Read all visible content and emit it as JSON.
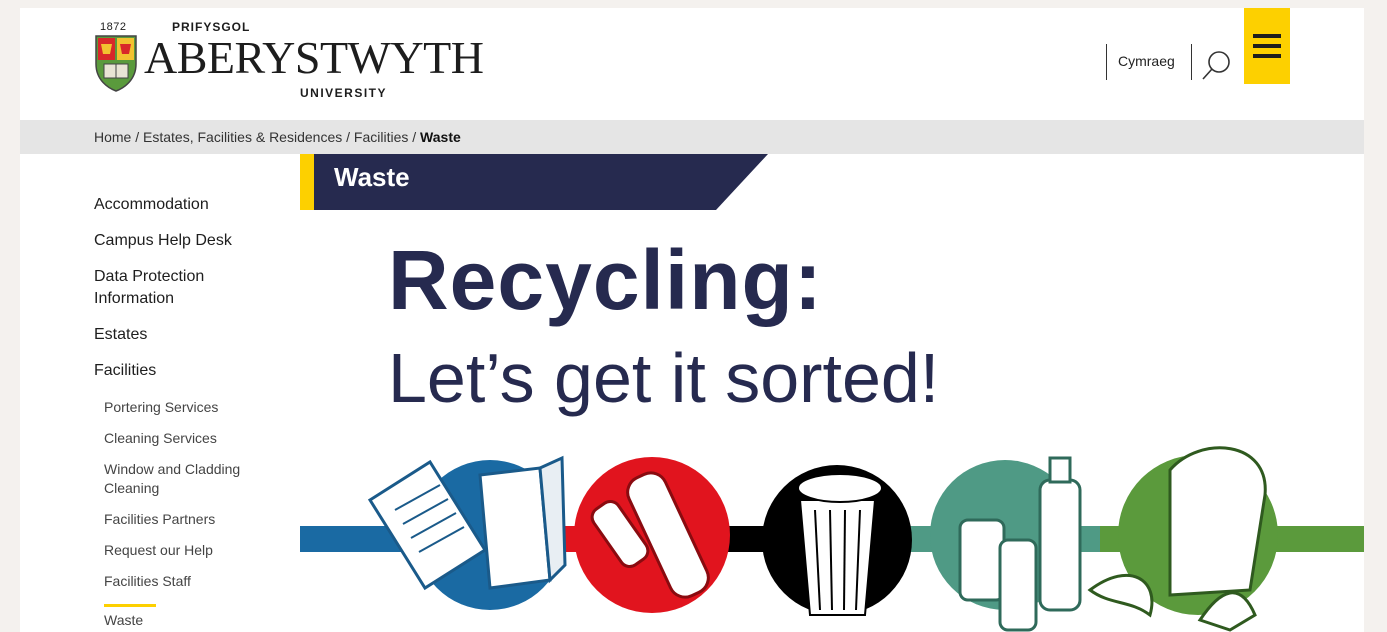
{
  "header": {
    "logo": {
      "year": "1872",
      "prifysgol": "PRIFYSGOL",
      "aberystwyth": "ABERYSTWYTH",
      "university": "UNIVERSITY"
    },
    "language_label": "Cymraeg",
    "search_icon": "search-icon",
    "menu_icon": "hamburger-menu-icon",
    "accent_color": "#fdd000"
  },
  "breadcrumb": {
    "items": [
      "Home",
      "Estates, Facilities & Residences",
      "Facilities"
    ],
    "separator": " / ",
    "current": "Waste"
  },
  "sidebar": {
    "top_items": [
      {
        "label": "Accommodation"
      },
      {
        "label": "Campus Help Desk"
      },
      {
        "label": "Data Protection Information"
      },
      {
        "label": "Estates"
      },
      {
        "label": "Facilities"
      }
    ],
    "sub_items": [
      {
        "label": "Portering Services"
      },
      {
        "label": "Cleaning Services"
      },
      {
        "label": "Window and Cladding Cleaning"
      },
      {
        "label": "Facilities Partners"
      },
      {
        "label": "Request our Help"
      },
      {
        "label": "Facilities Staff"
      },
      {
        "label": "Waste"
      }
    ]
  },
  "main": {
    "page_title": "Waste",
    "hero_heading": "Recycling:",
    "hero_subheading": "Let’s get it sorted!",
    "title_bar_color": "#262a4f",
    "bin_colors": [
      "#1a6aa3",
      "#e1141e",
      "#000000",
      "#4f9a85",
      "#5b9a3c"
    ],
    "bin_icons": [
      "paper-cardboard-icon",
      "plastic-cans-icon",
      "general-waste-bin-icon",
      "glass-bottles-icon",
      "food-waste-icon"
    ]
  }
}
